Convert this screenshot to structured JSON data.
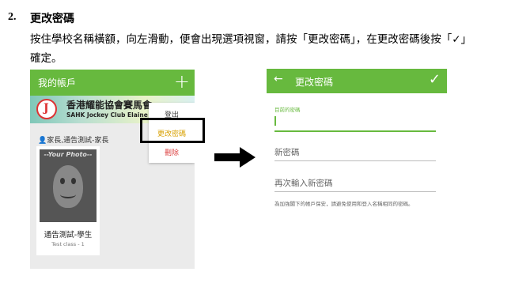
{
  "step": {
    "number": "2.",
    "title": "更改密碼",
    "instruction_line1": "按住學校名稱橫額，向左滑動，便會出現選項視窗，請按「更改密碼」，在更改密碼後按「✓」",
    "instruction_line2": "確定。"
  },
  "left_screen": {
    "header_title": "我的帳戶",
    "add_icon": "plus-icon",
    "school_name_cn": "香港耀能協會賽馬會",
    "school_name_en": "SAHK Jockey Club Elaine",
    "user_line": "家長,通告測試-家長",
    "student_photo_label": "--Your Photo--",
    "student_name": "通告測試-學生",
    "student_class": "Test class - 1",
    "menu": [
      "登出",
      "更改密碼",
      "刪除"
    ]
  },
  "right_screen": {
    "back_icon": "arrow-left-icon",
    "header_title": "更改密碼",
    "confirm_icon": "check-icon",
    "current_password_label": "目前的密碼",
    "new_password_placeholder": "新密碼",
    "confirm_password_placeholder": "再次輸入新密碼",
    "note": "為加強閣下的帳戶保安，請避免使用和登入名稱相同的密碼。"
  },
  "colors": {
    "accent": "#67b93e",
    "highlight_border": "#000000"
  }
}
